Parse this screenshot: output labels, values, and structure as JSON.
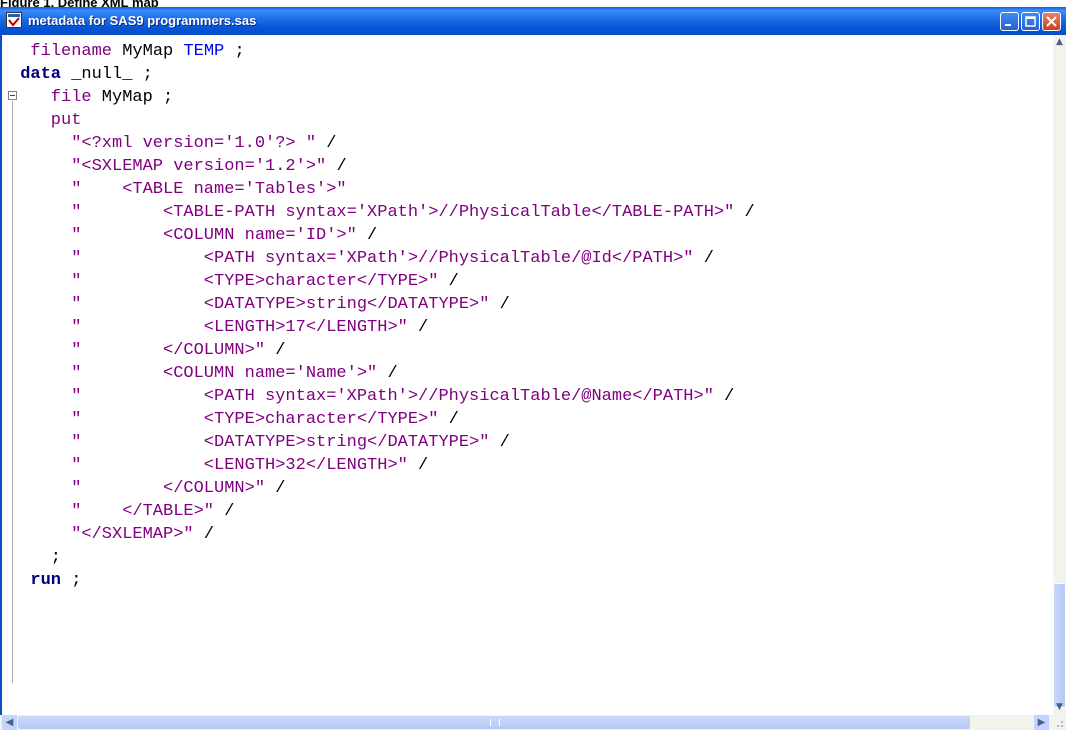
{
  "caption": "Figure 1. Define XML map",
  "window": {
    "title": "metadata for SAS9 programmers.sas",
    "icons": {
      "app": "sas-program-icon",
      "minimize": "minimize-icon",
      "maximize": "maximize-icon",
      "close": "close-icon"
    }
  },
  "code": {
    "lines": [
      {
        "indent": 2,
        "tokens": [
          {
            "t": "filename",
            "c": "str"
          },
          {
            "t": " MyMap ",
            "c": "ident"
          },
          {
            "t": "TEMP",
            "c": "kwb"
          },
          {
            "t": " ;",
            "c": "plain"
          }
        ]
      },
      {
        "indent": 1,
        "tokens": [
          {
            "t": "data",
            "c": "kw"
          },
          {
            "t": " _null_ ",
            "c": "ident"
          },
          {
            "t": ";",
            "c": "plain"
          }
        ]
      },
      {
        "indent": 4,
        "tokens": [
          {
            "t": "file",
            "c": "str"
          },
          {
            "t": " MyMap ;",
            "c": "ident"
          }
        ]
      },
      {
        "indent": 4,
        "tokens": [
          {
            "t": "put",
            "c": "str"
          }
        ]
      },
      {
        "indent": 6,
        "tokens": [
          {
            "t": "\"<?xml version='1.0'?> \" ",
            "c": "str"
          },
          {
            "t": "/",
            "c": "plain"
          }
        ]
      },
      {
        "indent": 6,
        "tokens": [
          {
            "t": "\"<SXLEMAP version='1.2'>\" ",
            "c": "str"
          },
          {
            "t": "/",
            "c": "plain"
          }
        ]
      },
      {
        "indent": 6,
        "tokens": [
          {
            "t": "\"    <TABLE name='Tables'>\"",
            "c": "str"
          }
        ]
      },
      {
        "indent": 6,
        "tokens": [
          {
            "t": "\"        <TABLE-PATH syntax='XPath'>//PhysicalTable</TABLE-PATH>\" ",
            "c": "str"
          },
          {
            "t": "/",
            "c": "plain"
          }
        ]
      },
      {
        "indent": 6,
        "tokens": [
          {
            "t": "\"        <COLUMN name='ID'>\" ",
            "c": "str"
          },
          {
            "t": "/",
            "c": "plain"
          }
        ]
      },
      {
        "indent": 6,
        "tokens": [
          {
            "t": "\"            <PATH syntax='XPath'>//PhysicalTable/@Id</PATH>\" ",
            "c": "str"
          },
          {
            "t": "/",
            "c": "plain"
          }
        ]
      },
      {
        "indent": 6,
        "tokens": [
          {
            "t": "\"            <TYPE>character</TYPE>\" ",
            "c": "str"
          },
          {
            "t": "/",
            "c": "plain"
          }
        ]
      },
      {
        "indent": 6,
        "tokens": [
          {
            "t": "\"            <DATATYPE>string</DATATYPE>\" ",
            "c": "str"
          },
          {
            "t": "/",
            "c": "plain"
          }
        ]
      },
      {
        "indent": 6,
        "tokens": [
          {
            "t": "\"            <LENGTH>17</LENGTH>\" ",
            "c": "str"
          },
          {
            "t": "/",
            "c": "plain"
          }
        ]
      },
      {
        "indent": 6,
        "tokens": [
          {
            "t": "\"        </COLUMN>\" ",
            "c": "str"
          },
          {
            "t": "/",
            "c": "plain"
          }
        ]
      },
      {
        "indent": 6,
        "tokens": [
          {
            "t": "\"        <COLUMN name='Name'>\" ",
            "c": "str"
          },
          {
            "t": "/",
            "c": "plain"
          }
        ]
      },
      {
        "indent": 6,
        "tokens": [
          {
            "t": "\"            <PATH syntax='XPath'>//PhysicalTable/@Name</PATH>\" ",
            "c": "str"
          },
          {
            "t": "/",
            "c": "plain"
          }
        ]
      },
      {
        "indent": 6,
        "tokens": [
          {
            "t": "\"            <TYPE>character</TYPE>\" ",
            "c": "str"
          },
          {
            "t": "/",
            "c": "plain"
          }
        ]
      },
      {
        "indent": 6,
        "tokens": [
          {
            "t": "\"            <DATATYPE>string</DATATYPE>\" ",
            "c": "str"
          },
          {
            "t": "/",
            "c": "plain"
          }
        ]
      },
      {
        "indent": 6,
        "tokens": [
          {
            "t": "\"            <LENGTH>32</LENGTH>\" ",
            "c": "str"
          },
          {
            "t": "/",
            "c": "plain"
          }
        ]
      },
      {
        "indent": 6,
        "tokens": [
          {
            "t": "\"        </COLUMN>\" ",
            "c": "str"
          },
          {
            "t": "/",
            "c": "plain"
          }
        ]
      },
      {
        "indent": 6,
        "tokens": [
          {
            "t": "\"    </TABLE>\" ",
            "c": "str"
          },
          {
            "t": "/",
            "c": "plain"
          }
        ]
      },
      {
        "indent": 6,
        "tokens": [
          {
            "t": "\"</SXLEMAP>\" ",
            "c": "str"
          },
          {
            "t": "/",
            "c": "plain"
          }
        ]
      },
      {
        "indent": 4,
        "tokens": [
          {
            "t": ";",
            "c": "plain"
          }
        ]
      },
      {
        "indent": 2,
        "tokens": [
          {
            "t": "run",
            "c": "kw"
          },
          {
            "t": " ;",
            "c": "plain"
          }
        ]
      }
    ]
  },
  "scrollbars": {
    "icons": {
      "up": "scroll-up-arrow-icon",
      "down": "scroll-down-arrow-icon",
      "left": "scroll-left-arrow-icon",
      "right": "scroll-right-arrow-icon"
    }
  }
}
